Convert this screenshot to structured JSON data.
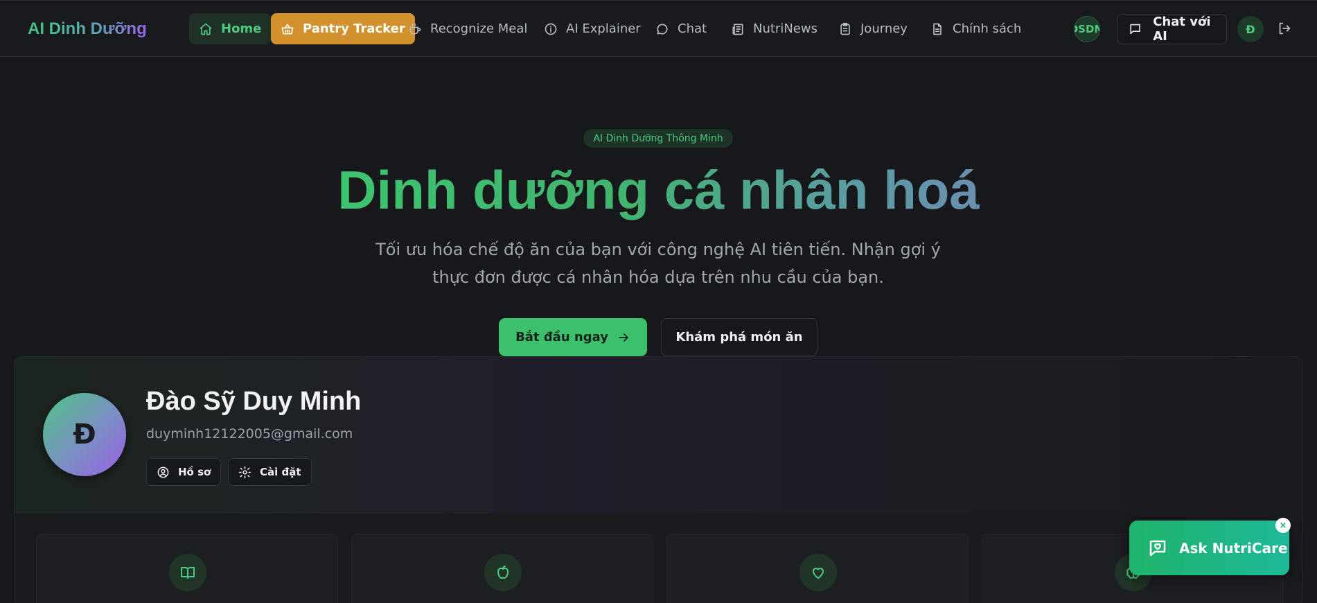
{
  "nav": {
    "brand": "AI Dinh Dưỡng",
    "items": [
      {
        "label": "Home",
        "icon": "home-icon"
      },
      {
        "label": "Pantry Tracker",
        "icon": "basket-icon"
      },
      {
        "label": "Recognize Meal",
        "icon": "coffee-icon"
      },
      {
        "label": "AI Explainer",
        "icon": "info-icon"
      },
      {
        "label": "Chat",
        "icon": "message-circle-icon"
      },
      {
        "label": "NutriNews",
        "icon": "newspaper-icon"
      },
      {
        "label": "Journey",
        "icon": "clipboard-icon"
      },
      {
        "label": "Chính sách",
        "icon": "file-text-icon"
      }
    ],
    "user_code": "DSDM",
    "chat_ai_label": "Chat với AI",
    "avatar_initial": "Đ"
  },
  "hero": {
    "badge": "AI Dinh Dưỡng Thông Minh",
    "title": "Dinh dưỡng cá nhân hoá",
    "subtitle": "Tối ưu hóa chế độ ăn của bạn với công nghệ AI tiên tiến. Nhận gợi ý thực đơn được cá nhân hóa dựa trên nhu cầu của bạn.",
    "primary_button": "Bắt đầu ngay",
    "secondary_button": "Khám phá món ăn"
  },
  "profile": {
    "initial": "Đ",
    "name": "Đào Sỹ Duy Minh",
    "email": "duyminh12122005@gmail.com",
    "profile_button": "Hồ sơ",
    "settings_button": "Cài đặt"
  },
  "features": [
    {
      "icon": "book-open-icon"
    },
    {
      "icon": "apple-icon"
    },
    {
      "icon": "heart-icon"
    },
    {
      "icon": "brain-icon"
    }
  ],
  "floating": {
    "label": "Ask NutriCare",
    "close": "×"
  },
  "colors": {
    "accent_green": "#3cc06c",
    "pantry_orange": "#d3912e",
    "background": "#17181b"
  }
}
